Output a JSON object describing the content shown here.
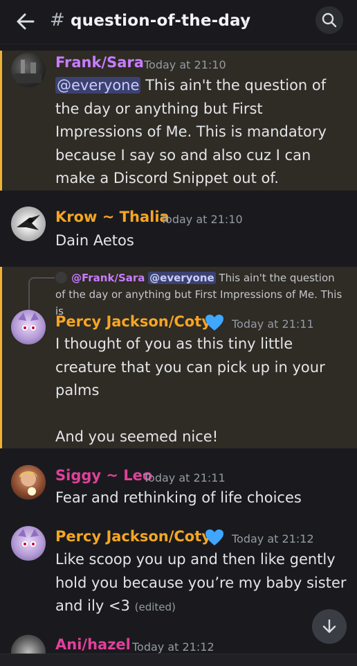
{
  "header": {
    "channel_hash": "#",
    "channel_name": "question-of-the-day",
    "chevron": "›"
  },
  "icons": {
    "back": "back-arrow-icon",
    "search": "search-icon",
    "scroll": "arrow-down-icon",
    "heart": "blue-heart-icon"
  },
  "colors": {
    "mention_highlight": "#f0b232",
    "mention_bg": "#2f2b25",
    "ping_bg": "#3c4270",
    "author_purple": "#c77dff",
    "author_orange": "#f5a623",
    "author_pink": "#e0409a",
    "heart_blue": "#3fa7ff"
  },
  "messages": [
    {
      "author": "Frank/Sara",
      "timestamp": "Today at 21:10",
      "ping": "@everyone",
      "text": " This ain't the question of the day or anything but First Impressions of Me. This is mandatory because I say so and also cuz I can make a Discord Snippet out of."
    },
    {
      "author": "Krow ~ Thalia",
      "timestamp": "Today at 21:10",
      "text": "Dain Aetos"
    },
    {
      "reply": {
        "author": "@Frank/Sara",
        "ping": "@everyone",
        "text": " This ain't the question of the day or anything but First Impressions of Me. This is"
      },
      "author": "Percy Jackson/Coty",
      "timestamp": "Today at 21:11",
      "text": "I thought of you as this tiny little creature that you can pick up in your palms\n\nAnd you seemed nice!"
    },
    {
      "author": "Siggy ~ Leo",
      "timestamp": "Today at 21:11",
      "text": "Fear and rethinking of life choices"
    },
    {
      "author": "Percy Jackson/Coty",
      "timestamp": "Today at 21:12",
      "text": "Like scoop you up and then like gently hold you because you’re my baby sister and ily <3",
      "edited": "(edited)"
    },
    {
      "author": "Ani/hazel",
      "timestamp": "Today at 21:12"
    }
  ]
}
